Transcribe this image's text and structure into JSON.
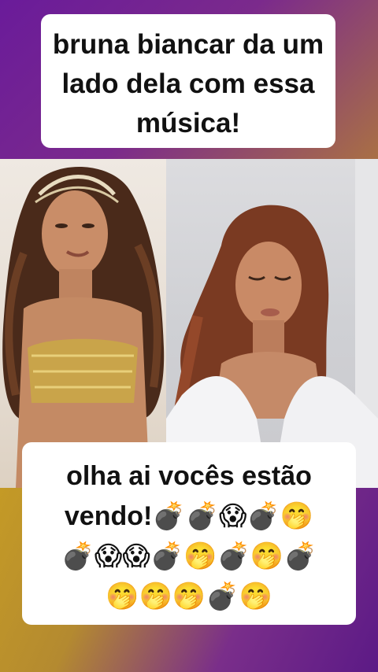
{
  "caption_top": {
    "line1": "bruna biancar da um",
    "line2": "lado dela com essa",
    "line3": "música!"
  },
  "caption_bottom": {
    "line1": "olha ai vocês estão",
    "line2": "vendo!💣💣😱💣🤭",
    "line3": "💣😱😱💣🤭💣🤭💣",
    "line4": "🤭🤭🤭💣🤭"
  }
}
